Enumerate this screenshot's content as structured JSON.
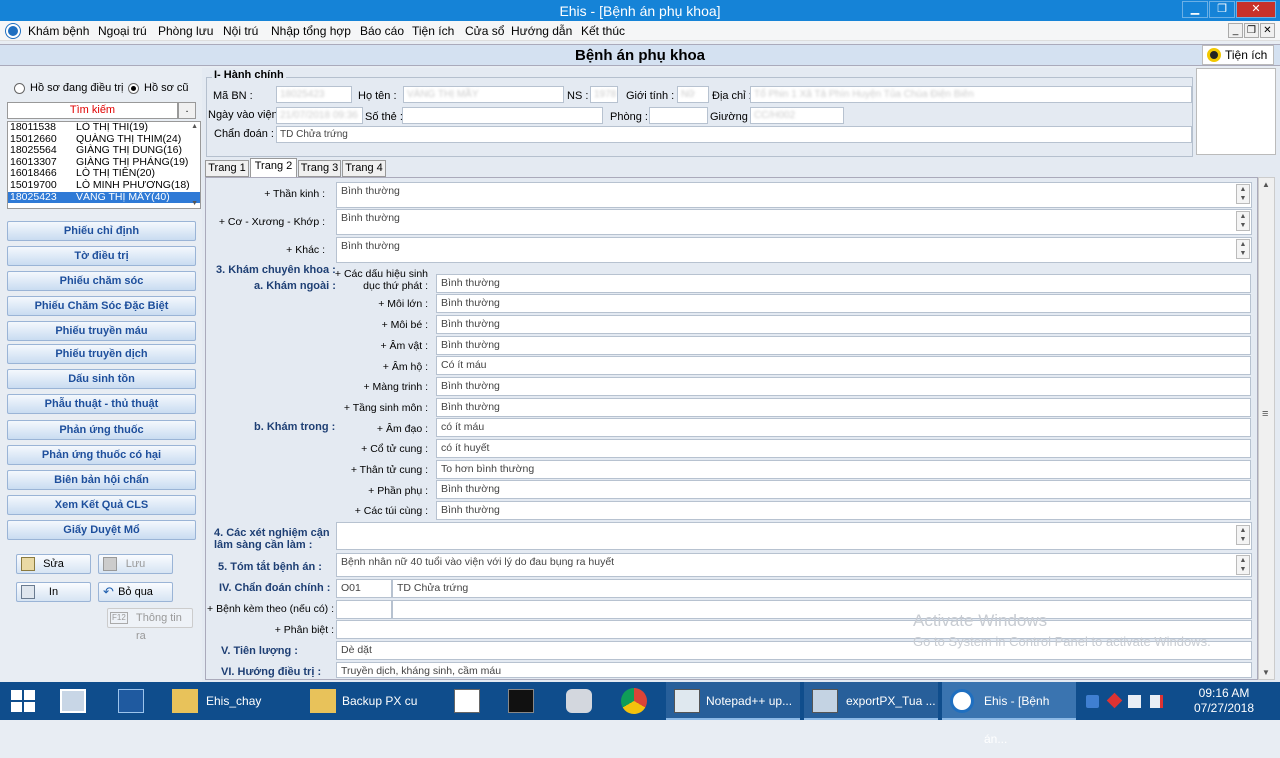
{
  "window": {
    "title": "Ehis - [Bệnh án phụ khoa]"
  },
  "menu": [
    "Khám bệnh",
    "Ngoại trú",
    "Phòng lưu",
    "Nội trú",
    "Nhập tổng hợp",
    "Báo cáo",
    "Tiện ích",
    "Cửa sổ",
    "Hướng dẫn",
    "Kết thúc"
  ],
  "header": {
    "title": "Bệnh án phụ khoa",
    "tienich": "Tiện ích"
  },
  "left": {
    "radio1": "Hồ sơ đang điều trị",
    "radio2": "Hồ sơ cũ",
    "search": "Tìm kiếm",
    "patients": [
      {
        "id": "18011538",
        "name": "LÒ THỊ THI(19)"
      },
      {
        "id": "15012660",
        "name": "QUÀNG THỊ THIM(24)"
      },
      {
        "id": "18025564",
        "name": "GIÀNG THỊ DUNG(16)"
      },
      {
        "id": "16013307",
        "name": "GIÀNG THỊ PHÁNG(19)"
      },
      {
        "id": "16018466",
        "name": "LÒ THỊ TIÊN(20)"
      },
      {
        "id": "15019700",
        "name": "LÒ MINH PHƯƠNG(18)"
      },
      {
        "id": "18025423",
        "name": "VÀNG THỊ MẦY(40)"
      }
    ],
    "nav": [
      "Phiếu chỉ định",
      "Tờ điều trị",
      "Phiếu chăm sóc",
      "Phiếu Chăm Sóc Đặc Biệt",
      "Phiếu truyền máu",
      "Phiếu truyền dịch",
      "Dấu sinh tồn",
      "Phẫu thuật - thủ thuật",
      "Phản ứng thuốc",
      "Phản ứng thuốc có hại",
      "Biên bản hội chẩn",
      "Xem Kết Quả CLS",
      "Giấy Duyệt Mổ"
    ],
    "actions": {
      "sua": "Sửa",
      "luu": "Lưu",
      "in": "In",
      "boqua": "Bỏ qua",
      "f12": "F12",
      "thongtin": "Thông tin ra"
    }
  },
  "hanhchinh": {
    "section": "I- Hành chính",
    "mabn_label": "Mã BN :",
    "mabn": "18025423",
    "hoten_label": "Họ tên :",
    "hoten": "VÀNG THỊ MẦY",
    "ns_label": "NS :",
    "ns": "1978",
    "gioitinh_label": "Giới tính :",
    "gioitinh": "Nữ",
    "diachi_label": "Địa chỉ :",
    "diachi": "Tổ Phin 1 Xã Tả Phìn Huyện Tủa Chùa Điện Biên",
    "ngayvao_label": "Ngày vào viện",
    "ngayvao": "21/07/2018 09:36",
    "sothe_label": "Số thẻ :",
    "sothe": "",
    "phong_label": "Phòng :",
    "phong": "",
    "giuong_label": "Giường :",
    "giuong": "CC/H002",
    "chandoan_label": "Chẩn đoán :",
    "chandoan": "TD Chửa trứng"
  },
  "tabs": [
    "Trang 1",
    "Trang 2",
    "Trang 3",
    "Trang 4"
  ],
  "form": {
    "thankinh_l": "+ Thần kinh :",
    "thankinh": "Bình thường",
    "coxuong_l": "+ Cơ - Xương - Khớp :",
    "coxuong": "Bình thường",
    "khac_l": "+ Khác :",
    "khac": "Bình thường",
    "s3": "3. Khám chuyên khoa :",
    "s3a": "a. Khám ngoài :",
    "s3b": "b. Khám trong :",
    "dauhieu_l1": "+ Các dấu hiệu sinh",
    "dauhieu_l2": "dục thứ phát :",
    "dauhieu": "Bình thường",
    "moilon_l": "+ Môi lớn :",
    "moilon": "Bình thường",
    "moibe_l": "+ Môi bé :",
    "moibe": "Bình thường",
    "amvat_l": "+ Âm vật :",
    "amvat": "Bình thường",
    "amho_l": "+ Âm hộ :",
    "amho": "Có ít máu",
    "mangtrinh_l": "+ Màng trinh :",
    "mangtrinh": "Bình thường",
    "tangsinh_l": "+ Tầng sinh môn :",
    "tangsinh": "Bình thường",
    "amdao_l": "+ Âm đạo :",
    "amdao": "có ít máu",
    "cotu_l": "+ Cổ tử cung :",
    "cotu": "có ít huyết",
    "thantu_l": "+ Thân tử cung :",
    "thantu": "To hơn bình thường",
    "phanphu_l": "+ Phần phụ :",
    "phanphu": "Bình thường",
    "tuicung_l": "+ Các túi cùng :",
    "tuicung": "Bình thường",
    "s4_1": "4. Các xét nghiệm cận",
    "s4_2": "lâm sàng cần làm :",
    "s4": "",
    "s5": "5. Tóm tắt bệnh án :",
    "tomtat": "Bệnh nhân nữ 40 tuổi vào viện với lý do đau bụng ra huyết",
    "s_iv": "IV. Chẩn đoán chính :",
    "cd_code": "O01",
    "cd_text": "TD Chửa trứng",
    "kemtheo_l": "+ Bệnh kèm theo (nếu có) :",
    "phanbiet_l": "+ Phân biệt :",
    "s_v": "V. Tiên lượng :",
    "tienluong": "Dè dặt",
    "s_vi": "VI. Hướng điều trị :",
    "huongdieutri": "Truyền dịch, kháng sinh, cầm máu"
  },
  "watermark": {
    "l1": "Activate Windows",
    "l2": "Go to System in Control Panel to activate Windows."
  },
  "taskbar": {
    "items": [
      "Ehis_chay",
      "Backup PX cu",
      "Notepad++ up...",
      "exportPX_Tua ...",
      "Ehis - [Bệnh án..."
    ],
    "time": "09:16 AM",
    "date": "07/27/2018"
  }
}
